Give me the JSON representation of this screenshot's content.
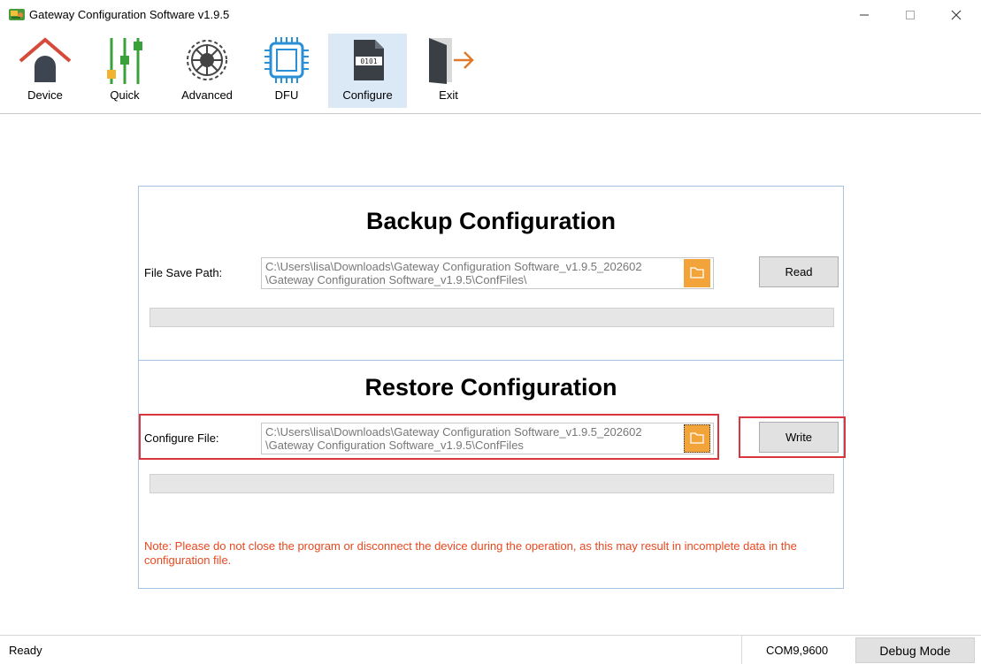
{
  "window": {
    "title": "Gateway Configuration Software v1.9.5",
    "controls": {
      "minimize": "—",
      "maximize": "☐",
      "close": "✕"
    }
  },
  "toolbar": {
    "items": [
      {
        "label": "Device",
        "icon": "house-icon"
      },
      {
        "label": "Quick",
        "icon": "sliders-icon"
      },
      {
        "label": "Advanced",
        "icon": "gear-icon"
      },
      {
        "label": "DFU",
        "icon": "chip-icon"
      },
      {
        "label": "Configure",
        "icon": "binary-file-icon",
        "active": true
      },
      {
        "label": "Exit",
        "icon": "exit-door-icon"
      }
    ]
  },
  "backup": {
    "heading": "Backup Configuration",
    "path_label": "File Save Path:",
    "path_line1": "C:\\Users\\lisa\\Downloads\\Gateway Configuration Software_v1.9.5_202602",
    "path_line2": "\\Gateway Configuration Software_v1.9.5\\ConfFiles\\",
    "button": "Read"
  },
  "restore": {
    "heading": "Restore Configuration",
    "path_label": "Configure File:",
    "path_line1": "C:\\Users\\lisa\\Downloads\\Gateway Configuration Software_v1.9.5_202602",
    "path_line2": "\\Gateway Configuration Software_v1.9.5\\ConfFiles",
    "button": "Write"
  },
  "note": "Note: Please do not close the program or disconnect the device during the operation, as this may result in incomplete data in the configuration file.",
  "status": {
    "left": "Ready",
    "port": "COM9,9600",
    "mode_button": "Debug Mode"
  },
  "colors": {
    "accent_active": "#dbe9f6",
    "folder": "#f2a33a",
    "note": "#e8481f",
    "highlight": "#d9363e",
    "panel_border": "#a8c4e4"
  }
}
